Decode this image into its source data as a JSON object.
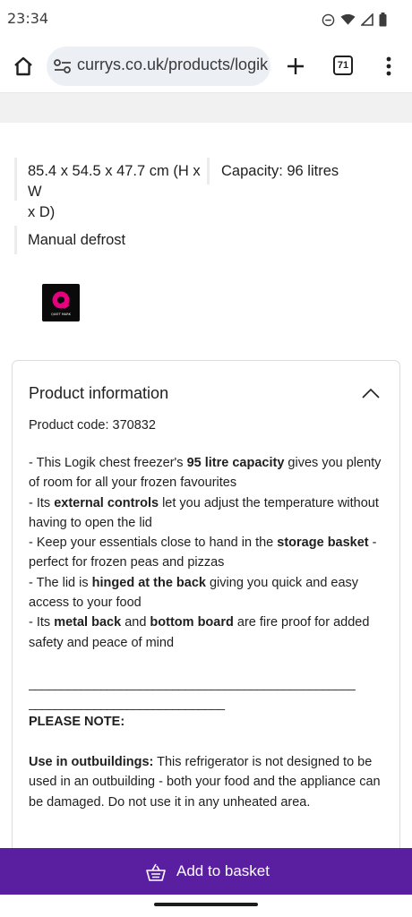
{
  "status_bar": {
    "time": "23:34",
    "icons": [
      "dnd-icon",
      "wifi-icon",
      "signal-icon",
      "battery-icon"
    ]
  },
  "browser": {
    "url": "currys.co.uk/products/logik",
    "tab_count": "71",
    "icons": [
      "home-icon",
      "site-settings-icon",
      "plus-icon",
      "tabs-icon",
      "more-vert-icon"
    ]
  },
  "specs": {
    "dimensions": "85.4 x 54.5 x 47.7 cm (H x W x D)",
    "dimensions_line1": "85.4 x 54.5 x 47.7 cm (H x W",
    "dimensions_line2": "x D)",
    "capacity": "Capacity: 96 litres",
    "defrost": "Manual defrost",
    "badge_text": "QUIET MARK"
  },
  "product_info": {
    "title": "Product information",
    "product_code": "Product code: 370832",
    "bullets": [
      [
        "- This Logik chest freezer's ",
        "95 litre capacity",
        " gives you plenty of room for all your frozen favourites"
      ],
      [
        "- Its ",
        "external controls",
        " let you adjust the temperature without having to open the lid"
      ],
      [
        "- Keep your essentials close to hand in the ",
        "storage basket",
        " - perfect for frozen peas and pizzas"
      ],
      [
        "- The lid is ",
        "hinged at the back",
        " giving you quick and easy access to your food"
      ],
      [
        "- Its ",
        "metal back",
        " and ",
        "bottom board",
        " are fire proof for added safety and peace of mind"
      ]
    ],
    "dashes_line1": "__________________________________________________",
    "dashes_line2": "______________________________",
    "note_heading": "PLEASE NOTE:",
    "note_label": "Use in outbuildings:",
    "note_text": " This refrigerator is not designed to be used in an outbuilding - both your food and the appliance can be damaged. Do not use it in any unheated area."
  },
  "basket": {
    "label": "Add to basket"
  },
  "colors": {
    "brand_purple": "#5a1ea0",
    "quiet_mark_pink": "#e6007e"
  }
}
